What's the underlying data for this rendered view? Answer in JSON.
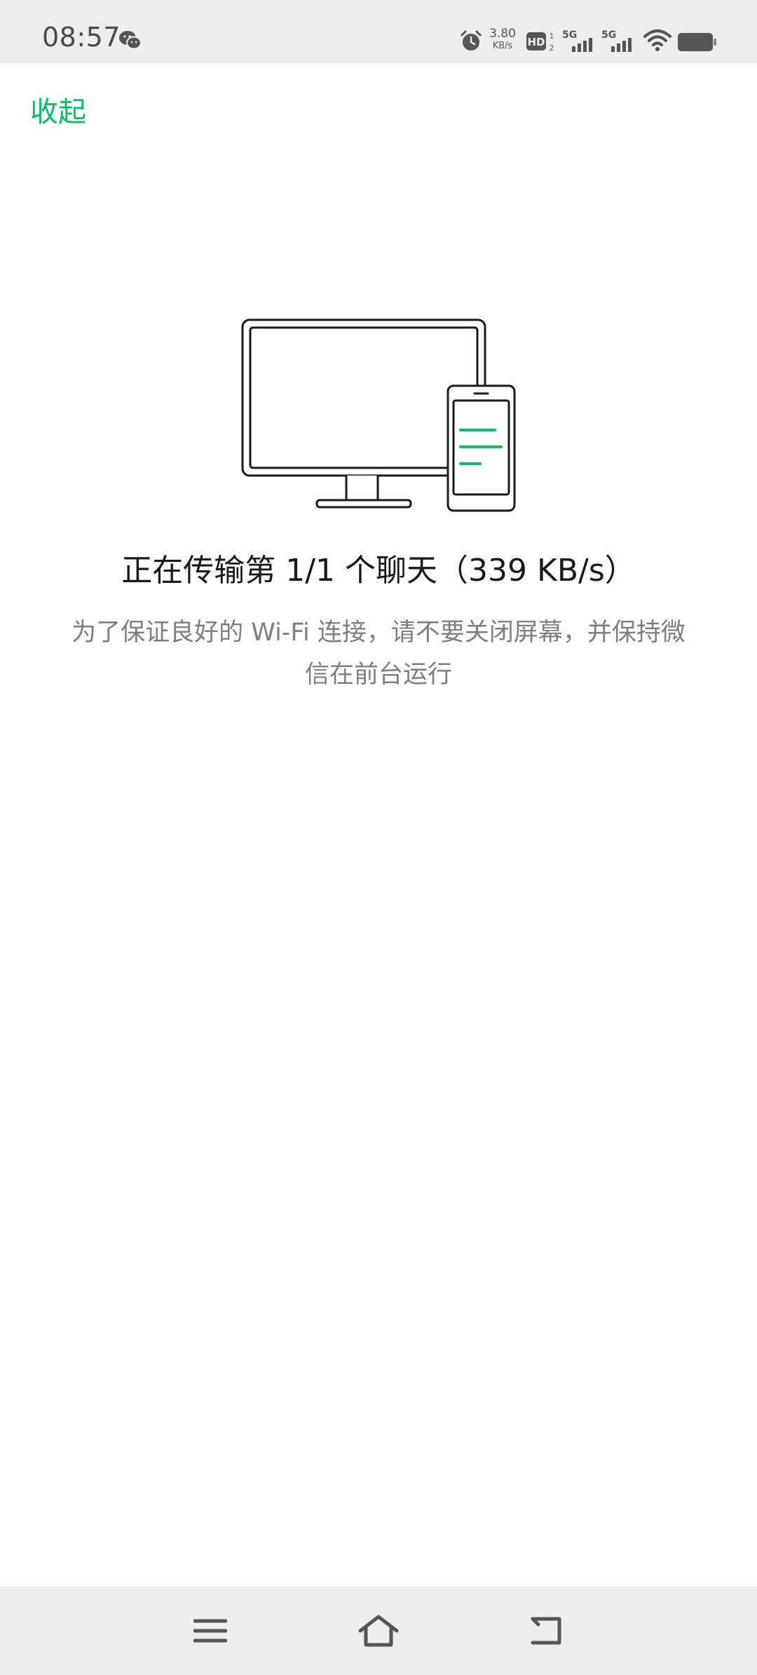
{
  "status_bar": {
    "time": "08:57",
    "net_speed_value": "3.80",
    "net_speed_unit": "KB/s",
    "icons": [
      "wechat-icon",
      "alarm-icon",
      "hd-icon",
      "5g-signal-icon",
      "5g-signal-icon",
      "wifi-icon",
      "battery-icon"
    ]
  },
  "header": {
    "collapse_label": "收起"
  },
  "transfer": {
    "title": "正在传输第 1/1 个聊天（339 KB/s）",
    "subtitle": "为了保证良好的 Wi-Fi 连接，请不要关闭屏幕，并保持微信在前台运行"
  },
  "nav_bar": {
    "icons": [
      "menu-icon",
      "home-icon",
      "back-icon"
    ]
  },
  "colors": {
    "accent": "#07c160",
    "bar_bg": "#ededed",
    "title_text": "#1a1a1a",
    "subtitle_text": "#7f7f7f"
  }
}
